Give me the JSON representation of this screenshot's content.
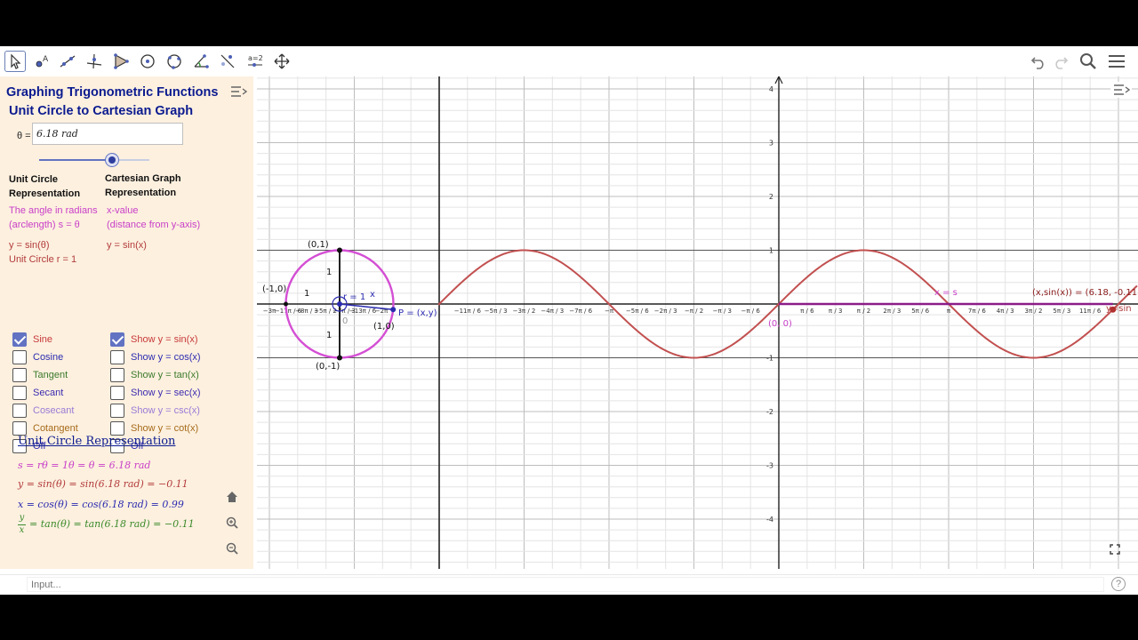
{
  "toolbar": {
    "tools": [
      "move-tool",
      "point-tool",
      "line-tool",
      "perpendicular-tool",
      "polygon-tool",
      "circle-tool",
      "circle-three-points-tool",
      "angle-tool",
      "reflect-tool",
      "slider-tool",
      "move-graphics-tool"
    ],
    "slider_tool_label": "a=2"
  },
  "sidebar": {
    "title": "Graphing Trigonometric Functions",
    "subtitle": "Unit Circle to Cartesian Graph",
    "theta_label": "θ =",
    "theta_value": "6.18 rad",
    "slider_fraction": 0.66,
    "col1_heading_1": "Unit Circle",
    "col1_heading_2": "Representation",
    "col2_heading_1": "Cartesian Graph",
    "col2_heading_2": "Representation",
    "col1_desc_1": "The angle in radians",
    "col1_desc_2": "(arclength)  s = θ",
    "col2_desc_1": "x-value",
    "col2_desc_2": "(distance from y-axis)",
    "col1_y": "y = sin(θ)",
    "col1_r": "Unit Circle r = 1",
    "col2_y": "y = sin(x)",
    "left_checks": [
      {
        "label": "Sine",
        "checked": true,
        "color": "#c73a3a"
      },
      {
        "label": "Cosine",
        "checked": false,
        "color": "#2b2bb0"
      },
      {
        "label": "Tangent",
        "checked": false,
        "color": "#3b7a2b"
      },
      {
        "label": "Secant",
        "checked": false,
        "color": "#3b2bb0"
      },
      {
        "label": "Cosecant",
        "checked": false,
        "color": "#9a7ad6"
      },
      {
        "label": "Cotangent",
        "checked": false,
        "color": "#a66a1a"
      },
      {
        "label": "Off",
        "checked": false,
        "color": "#2b2bb0"
      }
    ],
    "right_checks": [
      {
        "label": "Show y = sin(x)",
        "checked": true,
        "color": "#c73a3a"
      },
      {
        "label": "Show y = cos(x)",
        "checked": false,
        "color": "#2b2bb0"
      },
      {
        "label": "Show y = tan(x)",
        "checked": false,
        "color": "#3b7a2b"
      },
      {
        "label": "Show y = sec(x)",
        "checked": false,
        "color": "#3b2bb0"
      },
      {
        "label": "Show y = csc(x)",
        "checked": false,
        "color": "#9a7ad6"
      },
      {
        "label": "Show y = cot(x)",
        "checked": false,
        "color": "#a66a1a"
      },
      {
        "label": "Off",
        "checked": false,
        "color": "#2b2bb0"
      }
    ],
    "ucr_heading": "Unit Circle Representation",
    "eq_s": "s = rθ = 1θ =  θ = 6.18 rad",
    "eq_y": "y = sin(θ) = sin(6.18 rad) =  −0.11",
    "eq_x": "x = cos(θ) = cos(6.18 rad) =  0.99",
    "eq_tan_num": "y",
    "eq_tan_den": "x",
    "eq_tan_rest": "= tan(θ) = tan(6.18 rad) = −0.11",
    "colors": {
      "pink": "#c83fc8",
      "red": "#b23b3b",
      "blue": "#3b3bb2",
      "green": "#3b8a2b",
      "navy": "#0b1a8f"
    }
  },
  "graph": {
    "y_ticks": [
      "4",
      "3",
      "2",
      "1",
      "-1",
      "-2",
      "-3",
      "-4"
    ],
    "x_ticks_left": [
      "−11π / 6",
      "−5π / 3",
      "−3π / 2",
      "−4π / 3",
      "−7π / 6",
      "−π",
      "−5π / 6",
      "−2π / 3",
      "−π / 2",
      "−π / 3",
      "−π / 6"
    ],
    "x_ticks_right": [
      "π / 6",
      "π / 3",
      "π / 2",
      "2π / 3",
      "5π / 6",
      "π",
      "7π / 6",
      "4π / 3",
      "3π / 2",
      "5π / 3",
      "11π / 6"
    ],
    "circle_x_ticks": [
      "−3π",
      "−17π / 6",
      "−8π / 3",
      "−5π / 2",
      "−7π / 3",
      "−13π / 6",
      "−2π"
    ],
    "circle_labels": {
      "top": "(0,1)",
      "bottom": "(0,-1)",
      "left": "(-1,0)",
      "right": "(1,0)",
      "one_top": "1",
      "one_left": "1",
      "one_bottom": "1",
      "r": "r = 1",
      "x": "x",
      "zero": "0",
      "point": "P = (x,y)"
    },
    "origin_label": "(0, 0)",
    "x_eq_s": "x = s",
    "point_label": "(x,sin(x)) = (6.18, -0.11)",
    "y_sin_label": "y=sin",
    "theta": 6.18,
    "sine_color": "#c25050",
    "circle_color": "#d44fd4"
  },
  "inputbar": {
    "placeholder": "Input..."
  }
}
